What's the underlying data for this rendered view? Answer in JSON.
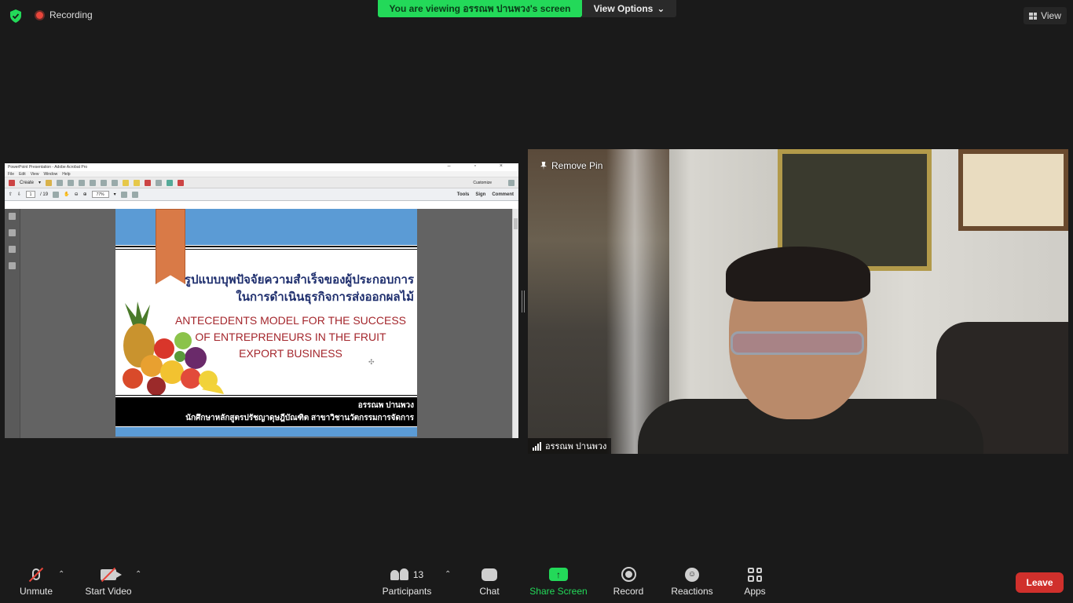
{
  "topbar": {
    "recording_label": "Recording",
    "viewing_banner": "You are viewing อรรณพ ปานพวง's screen",
    "view_options_label": "View Options",
    "view_label": "View"
  },
  "acrobat": {
    "window_title": "PowerPoint Presentation - Adobe Acrobat Pro",
    "window_controls": "– ▫ ×",
    "menu": [
      "File",
      "Edit",
      "View",
      "Window",
      "Help"
    ],
    "create_label": "Create",
    "customize_label": "Customize",
    "page_current": "1",
    "page_total": "/ 19",
    "zoom": "77%",
    "tools_label": "Tools",
    "sign_label": "Sign",
    "comment_label": "Comment"
  },
  "slide": {
    "thai_title_line1": "รูปแบบบุพปัจจัยความสำเร็จของผู้ประกอบการ",
    "thai_title_line2": "ในการดำเนินธุรกิจการส่งออกผลไม้",
    "eng_title_line1": "ANTECEDENTS MODEL FOR THE SUCCESS",
    "eng_title_line2": "OF ENTREPRENEURS IN THE FRUIT",
    "eng_title_line3": "EXPORT BUSINESS",
    "author_name": "อรรณพ ปานพวง",
    "author_affiliation": "นักศึกษาหลักสูตรปรัชญาดุษฎีบัณฑิต สาขาวิชานวัตกรรมการจัดการ"
  },
  "video": {
    "remove_pin_label": "Remove Pin",
    "participant_name": "อรรณพ ปานพวง"
  },
  "toolbar": {
    "unmute_label": "Unmute",
    "start_video_label": "Start Video",
    "participants_label": "Participants",
    "participants_count": "13",
    "chat_label": "Chat",
    "share_screen_label": "Share Screen",
    "record_label": "Record",
    "reactions_label": "Reactions",
    "apps_label": "Apps",
    "leave_label": "Leave"
  },
  "colors": {
    "share_green": "#23d959",
    "leave_red": "#d0302c",
    "slide_blue": "#5b9bd5",
    "slide_title_navy": "#1f2f6e",
    "slide_title_red": "#a4262c"
  }
}
